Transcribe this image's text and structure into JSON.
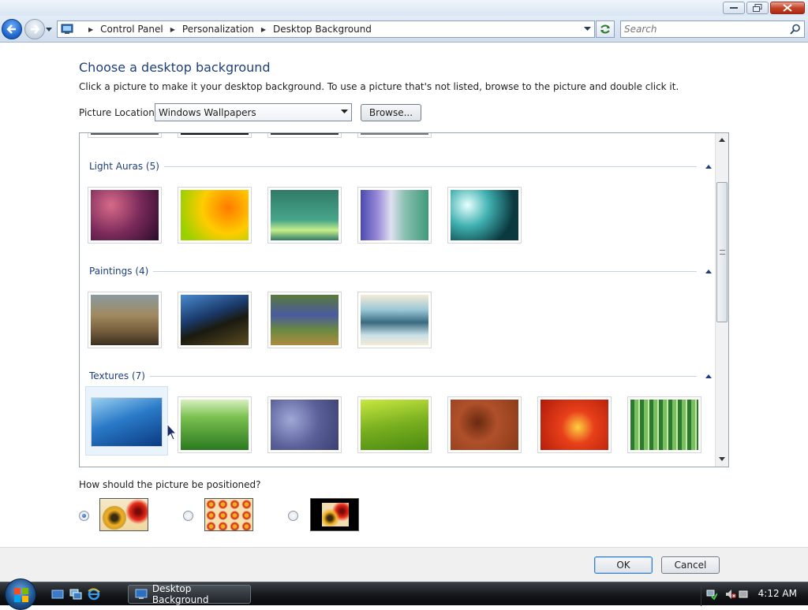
{
  "window": {
    "title": "Desktop Background"
  },
  "address": {
    "crumbs": [
      "Control Panel",
      "Personalization",
      "Desktop Background"
    ]
  },
  "search": {
    "placeholder": "Search"
  },
  "main": {
    "heading": "Choose a desktop background",
    "instruction": "Click a picture to make it your desktop background. To use a picture that's not listed, browse to the picture and double click it.",
    "location_label": "Picture Location",
    "location_value": "Windows Wallpapers",
    "browse_label": "Browse..."
  },
  "groups": [
    {
      "title": "Light Auras (5)",
      "count": 5
    },
    {
      "title": "Paintings (4)",
      "count": 4
    },
    {
      "title": "Textures (7)",
      "count": 7
    }
  ],
  "position": {
    "label": "How should the picture be positioned?",
    "options": [
      "fit",
      "tile",
      "center"
    ],
    "selected": "fit"
  },
  "dialog": {
    "ok_label": "OK",
    "cancel_label": "Cancel"
  },
  "taskbar": {
    "task_label": "Desktop Background",
    "clock": "4:12 AM"
  },
  "colors": {
    "heading": "#1e3f7a",
    "group_title": "#1e3f7a",
    "accent": "#3d7bbf"
  },
  "icons": [
    "control-panel-icon",
    "search-icon",
    "refresh-icon",
    "collapse-icon",
    "windows-logo-icon",
    "show-desktop-icon",
    "switch-windows-icon",
    "internet-explorer-icon",
    "network-icon",
    "volume-muted-icon",
    "cursor-icon"
  ]
}
